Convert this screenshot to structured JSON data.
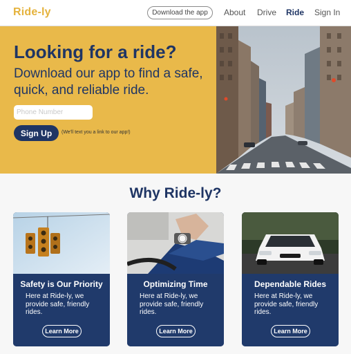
{
  "nav": {
    "logo": "Ride-ly",
    "download_button": "Download the app",
    "links": [
      "About",
      "Drive",
      "Ride",
      "Sign In"
    ],
    "active_link": "Ride"
  },
  "hero": {
    "title": "Looking for a ride?",
    "subtitle": "Download our app to find a safe, quick, and reliable ride.",
    "phone_placeholder": "Phone Number",
    "signup_label": "Sign Up",
    "hint": "(We'll text you a link to our app!)",
    "image": "city-street-photo"
  },
  "why": {
    "heading": "Why Ride-ly?",
    "cards": [
      {
        "title": "Safety is Our Priority",
        "text": "Here at Ride-ly, we provide safe, friendly rides.",
        "button": "Learn More",
        "image": "traffic-light-photo"
      },
      {
        "title": "Optimizing Time",
        "text": "Here at Ride-ly, we provide safe, friendly rides.",
        "button": "Learn More",
        "image": "wristwatch-driver-photo"
      },
      {
        "title": "Dependable Rides",
        "text": "Here at Ride-ly, we provide safe, friendly rides.",
        "button": "Learn More",
        "image": "white-car-photo"
      }
    ]
  },
  "colors": {
    "brand_yellow": "#e9b94a",
    "navy": "#1f3564",
    "card_navy": "#203a6b",
    "logo_gold": "#e5b33d"
  }
}
